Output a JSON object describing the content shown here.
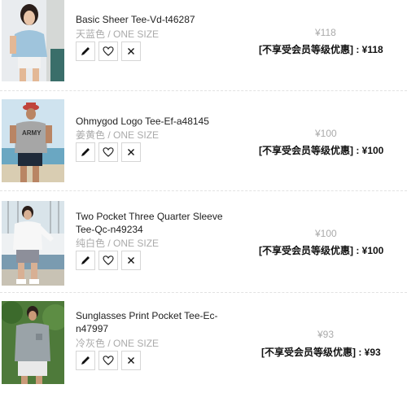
{
  "items": [
    {
      "name": "Basic Sheer Tee-Vd-t46287",
      "color": "天蓝色",
      "size": "ONE SIZE",
      "original_price": "¥118",
      "promo_text": "[不享受会员等级优惠] : ¥118",
      "image": "woman-blue-tee-photo"
    },
    {
      "name": "Ohmygod Logo Tee-Ef-a48145",
      "color": "姜黄色",
      "size": "ONE SIZE",
      "original_price": "¥100",
      "promo_text": "[不享受会员等级优惠] : ¥100",
      "image": "man-army-tee-beach-photo",
      "print_text": "ARMY"
    },
    {
      "name": "Two Pocket Three Quarter Sleeve Tee-Qc-n49234",
      "color": "纯白色",
      "size": "ONE SIZE",
      "original_price": "¥100",
      "promo_text": "[不享受会员等级优惠] : ¥100",
      "image": "man-white-tee-harbor-photo"
    },
    {
      "name": "Sunglasses Print Pocket Tee-Ec-n47997",
      "color": "冷灰色",
      "size": "ONE SIZE",
      "original_price": "¥93",
      "promo_text": "[不享受会员等级优惠] : ¥93",
      "image": "man-grey-tee-garden-photo"
    }
  ],
  "separator": "/",
  "actions": [
    "edit-icon",
    "heart-icon",
    "close-icon"
  ]
}
